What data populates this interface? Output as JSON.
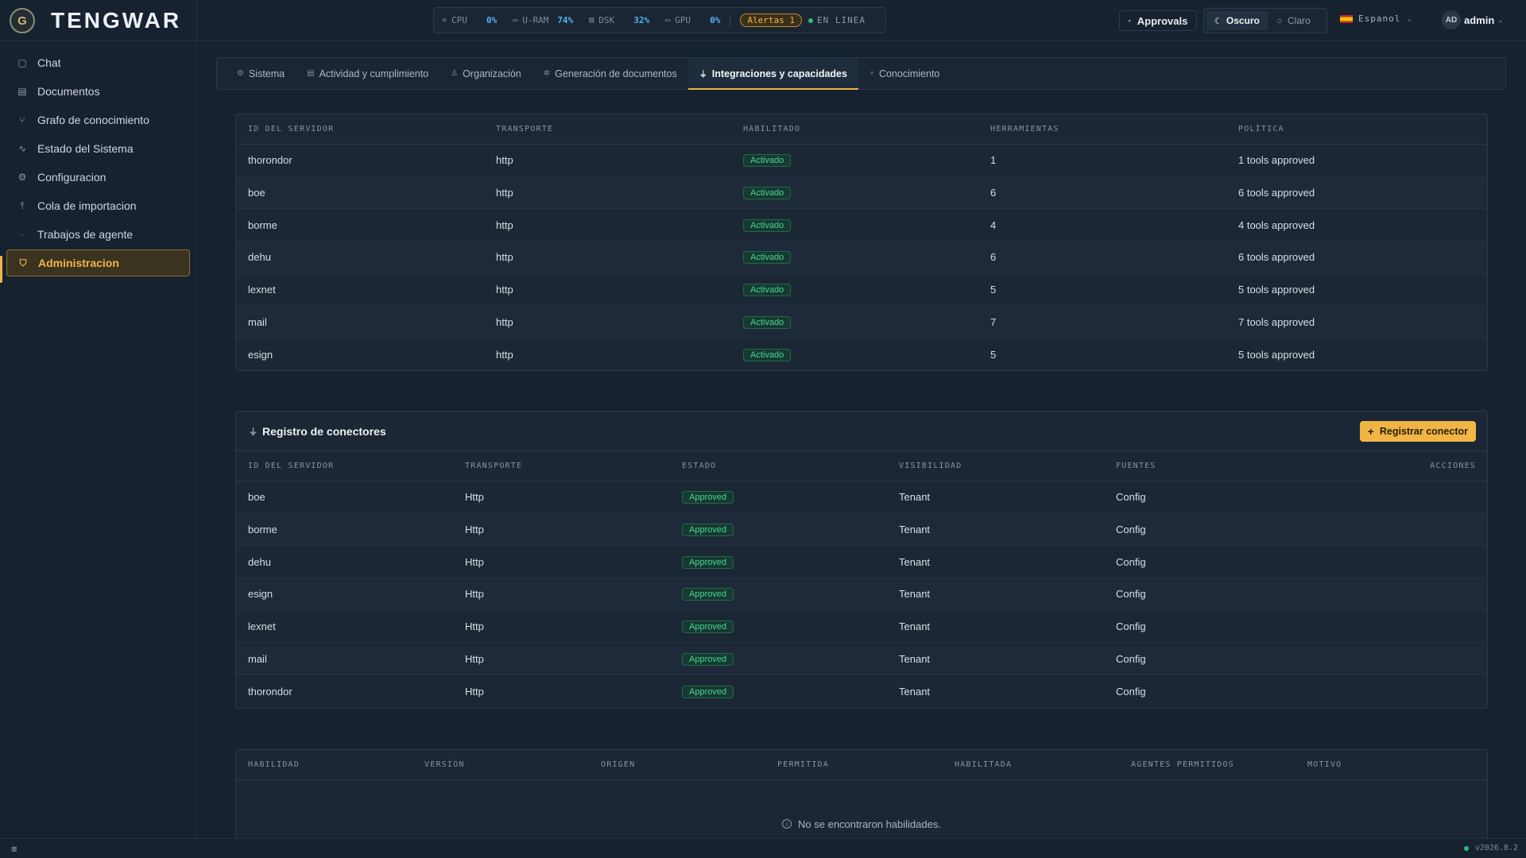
{
  "brand": {
    "name": "TENGWAR",
    "logo_letter": "G"
  },
  "metrics": [
    {
      "label": "CPU",
      "value": "0%",
      "icon": "cpu-icon",
      "glyph": "❊"
    },
    {
      "label": "U-RAM",
      "value": "74%",
      "icon": "ram-icon",
      "glyph": "▭"
    },
    {
      "label": "DSK",
      "value": "32%",
      "icon": "disk-icon",
      "glyph": "▤"
    },
    {
      "label": "GPU",
      "value": "0%",
      "icon": "gpu-icon",
      "glyph": "▭"
    }
  ],
  "alerts": "Alertas 1",
  "status": "EN LINEA",
  "header": {
    "approvals": "Approvals",
    "theme_dark": "Oscuro",
    "theme_light": "Claro",
    "language": "Espanol",
    "user_initials": "AD",
    "user_name": "admin"
  },
  "sidebar": {
    "items": [
      {
        "label": "Chat",
        "icon": "chat-icon",
        "glyph": "▢"
      },
      {
        "label": "Documentos",
        "icon": "document-icon",
        "glyph": "▤"
      },
      {
        "label": "Grafo de conocimiento",
        "icon": "graph-icon",
        "glyph": "⑂"
      },
      {
        "label": "Estado del Sistema",
        "icon": "activity-icon",
        "glyph": "∿"
      },
      {
        "label": "Configuracion",
        "icon": "gear-icon",
        "glyph": "⚙"
      },
      {
        "label": "Cola de importacion",
        "icon": "upload-icon",
        "glyph": "⤒"
      },
      {
        "label": "Trabajos de agente",
        "icon": "agent-icon",
        "glyph": "·"
      },
      {
        "label": "Administracion",
        "icon": "shield-icon",
        "glyph": "⛉"
      }
    ]
  },
  "tabs": [
    {
      "label": "Sistema",
      "icon": "gear-icon",
      "glyph": "⚙"
    },
    {
      "label": "Actividad y cumplimiento",
      "icon": "clipboard-icon",
      "glyph": "▤"
    },
    {
      "label": "Organización",
      "icon": "user-icon",
      "glyph": "♙"
    },
    {
      "label": "Generación de documentos",
      "icon": "sparkle-icon",
      "glyph": "✲"
    },
    {
      "label": "Integraciones y capacidades",
      "icon": "plug-icon",
      "glyph": "⏚"
    },
    {
      "label": "Conocimiento",
      "icon": "graph-icon",
      "glyph": "⑂"
    }
  ],
  "servers_table": {
    "headers": [
      "ID DEL SERVIDOR",
      "TRANSPORTE",
      "HABILITADO",
      "HERRAMIENTAS",
      "POLÍTICA"
    ],
    "rows": [
      {
        "id": "thorondor",
        "transport": "http",
        "enabled": "Activado",
        "tools": "1",
        "policy": "1 tools approved"
      },
      {
        "id": "boe",
        "transport": "http",
        "enabled": "Activado",
        "tools": "6",
        "policy": "6 tools approved"
      },
      {
        "id": "borme",
        "transport": "http",
        "enabled": "Activado",
        "tools": "4",
        "policy": "4 tools approved"
      },
      {
        "id": "dehu",
        "transport": "http",
        "enabled": "Activado",
        "tools": "6",
        "policy": "6 tools approved"
      },
      {
        "id": "lexnet",
        "transport": "http",
        "enabled": "Activado",
        "tools": "5",
        "policy": "5 tools approved"
      },
      {
        "id": "mail",
        "transport": "http",
        "enabled": "Activado",
        "tools": "7",
        "policy": "7 tools approved"
      },
      {
        "id": "esign",
        "transport": "http",
        "enabled": "Activado",
        "tools": "5",
        "policy": "5 tools approved"
      }
    ]
  },
  "connectors": {
    "title": "Registro de conectores",
    "register_button": "Registrar conector",
    "headers": [
      "ID DEL SERVIDOR",
      "TRANSPORTE",
      "ESTADO",
      "VISIBILIDAD",
      "FUENTES",
      "ACCIONES"
    ],
    "rows": [
      {
        "id": "boe",
        "transport": "Http",
        "state": "Approved",
        "visibility": "Tenant",
        "source": "Config"
      },
      {
        "id": "borme",
        "transport": "Http",
        "state": "Approved",
        "visibility": "Tenant",
        "source": "Config"
      },
      {
        "id": "dehu",
        "transport": "Http",
        "state": "Approved",
        "visibility": "Tenant",
        "source": "Config"
      },
      {
        "id": "esign",
        "transport": "Http",
        "state": "Approved",
        "visibility": "Tenant",
        "source": "Config"
      },
      {
        "id": "lexnet",
        "transport": "Http",
        "state": "Approved",
        "visibility": "Tenant",
        "source": "Config"
      },
      {
        "id": "mail",
        "transport": "Http",
        "state": "Approved",
        "visibility": "Tenant",
        "source": "Config"
      },
      {
        "id": "thorondor",
        "transport": "Http",
        "state": "Approved",
        "visibility": "Tenant",
        "source": "Config"
      }
    ]
  },
  "skills": {
    "headers": [
      "HABILIDAD",
      "VERSIÓN",
      "ORIGEN",
      "PERMITIDA",
      "HABILITADA",
      "AGENTES PERMITIDOS",
      "MOTIVO"
    ],
    "empty_message": "No se encontraron habilidades."
  },
  "footer": {
    "version": "v2026.8.2"
  }
}
